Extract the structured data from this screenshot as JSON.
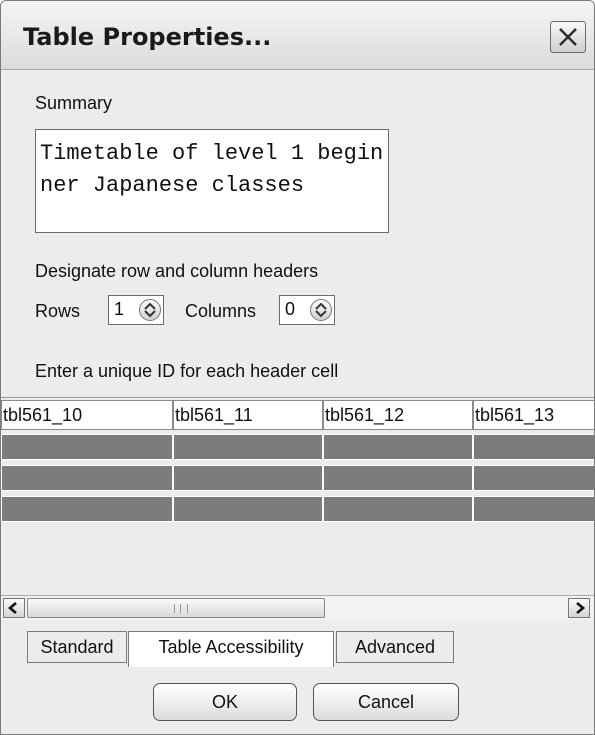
{
  "dialog": {
    "title": "Table Properties..."
  },
  "summary": {
    "label": "Summary",
    "value": "Timetable of level 1 beginner Japanese classes"
  },
  "headers": {
    "label": "Designate row and column headers",
    "rows_label": "Rows",
    "rows_value": "1",
    "columns_label": "Columns",
    "columns_value": "0"
  },
  "ids": {
    "label": "Enter a unique ID for each header cell",
    "cells": [
      "tbl561_10",
      "tbl561_11",
      "tbl561_12",
      "tbl561_13"
    ]
  },
  "tabs": [
    {
      "label": "Standard"
    },
    {
      "label": "Table Accessibility",
      "active": true
    },
    {
      "label": "Advanced"
    }
  ],
  "buttons": {
    "ok": "OK",
    "cancel": "Cancel"
  },
  "icons": {
    "close": "close-icon",
    "spin": "spin-up-down-icon",
    "scroll_left": "chevron-left-icon",
    "scroll_right": "chevron-right-icon"
  },
  "colors": {
    "window_bg": "#ececec",
    "grid_fill": "#7c7c7c"
  }
}
